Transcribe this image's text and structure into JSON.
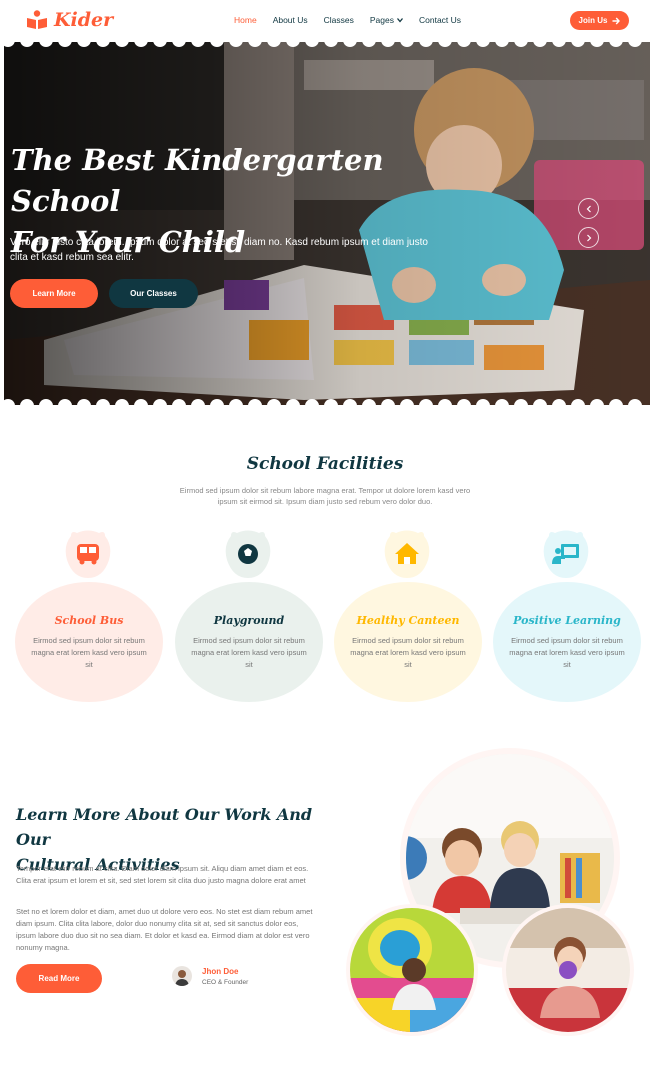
{
  "brand": {
    "name": "Kider",
    "icon": "book-reader-icon",
    "color": "#FE5D37"
  },
  "nav": {
    "items": [
      {
        "label": "Home",
        "active": true
      },
      {
        "label": "About Us"
      },
      {
        "label": "Classes"
      },
      {
        "label": "Pages",
        "dropdown": true
      },
      {
        "label": "Contact Us"
      }
    ],
    "join_label": "Join Us",
    "join_icon": "arrow-right-icon"
  },
  "hero": {
    "title_line1": "The Best Kindergarten School",
    "title_line2": "For Your Child",
    "text": "Vero elitr justo clita lorem. Ipsum dolor at sed stet sit diam no. Kasd rebum ipsum et diam justo clita et kasd rebum sea elitr.",
    "primary_label": "Learn More",
    "secondary_label": "Our Classes",
    "prev_icon": "chevron-left-icon",
    "next_icon": "chevron-right-icon"
  },
  "facilities": {
    "title": "School Facilities",
    "subtitle": "Eirmod sed ipsum dolor sit rebum labore magna erat. Tempor ut dolore lorem kasd vero ipsum sit eirmod sit. Ipsum diam justo sed rebum vero dolor duo.",
    "items": [
      {
        "name": "School Bus",
        "icon": "bus-icon",
        "color": "#FE5D37",
        "bg": "#FFECE7",
        "desc": "Eirmod sed ipsum dolor sit rebum magna erat lorem kasd vero ipsum sit"
      },
      {
        "name": "Playground",
        "icon": "football-icon",
        "color": "#103741",
        "bg": "#EAF1ED",
        "desc": "Eirmod sed ipsum dolor sit rebum magna erat lorem kasd vero ipsum sit"
      },
      {
        "name": "Healthy Canteen",
        "icon": "home-icon",
        "color": "#FFB800",
        "bg": "#FFF7E0",
        "desc": "Eirmod sed ipsum dolor sit rebum magna erat lorem kasd vero ipsum sit"
      },
      {
        "name": "Positive Learning",
        "icon": "chalkboard-teacher-icon",
        "color": "#2AB6C9",
        "bg": "#E4F7FA",
        "desc": "Eirmod sed ipsum dolor sit rebum magna erat lorem kasd vero ipsum sit"
      }
    ]
  },
  "about": {
    "title_line1": "Learn More About Our Work And Our",
    "title_line2": "Cultural Activities",
    "para1": "Tempor erat elitr rebum at clita. Diam dolor diam ipsum sit. Aliqu diam amet diam et eos. Clita erat ipsum et lorem et sit, sed stet lorem sit clita duo justo magna dolore erat amet",
    "para2": "Stet no et lorem dolor et diam, amet duo ut dolore vero eos. No stet est diam rebum amet diam ipsum. Clita clita labore, dolor duo nonumy clita sit at, sed sit sanctus dolor eos, ipsum labore duo duo sit no sea diam. Et dolor et kasd ea. Eirmod diam at dolor est vero nonumy magna.",
    "button_label": "Read More",
    "author_name": "Jhon Doe",
    "author_role": "CEO & Founder"
  }
}
